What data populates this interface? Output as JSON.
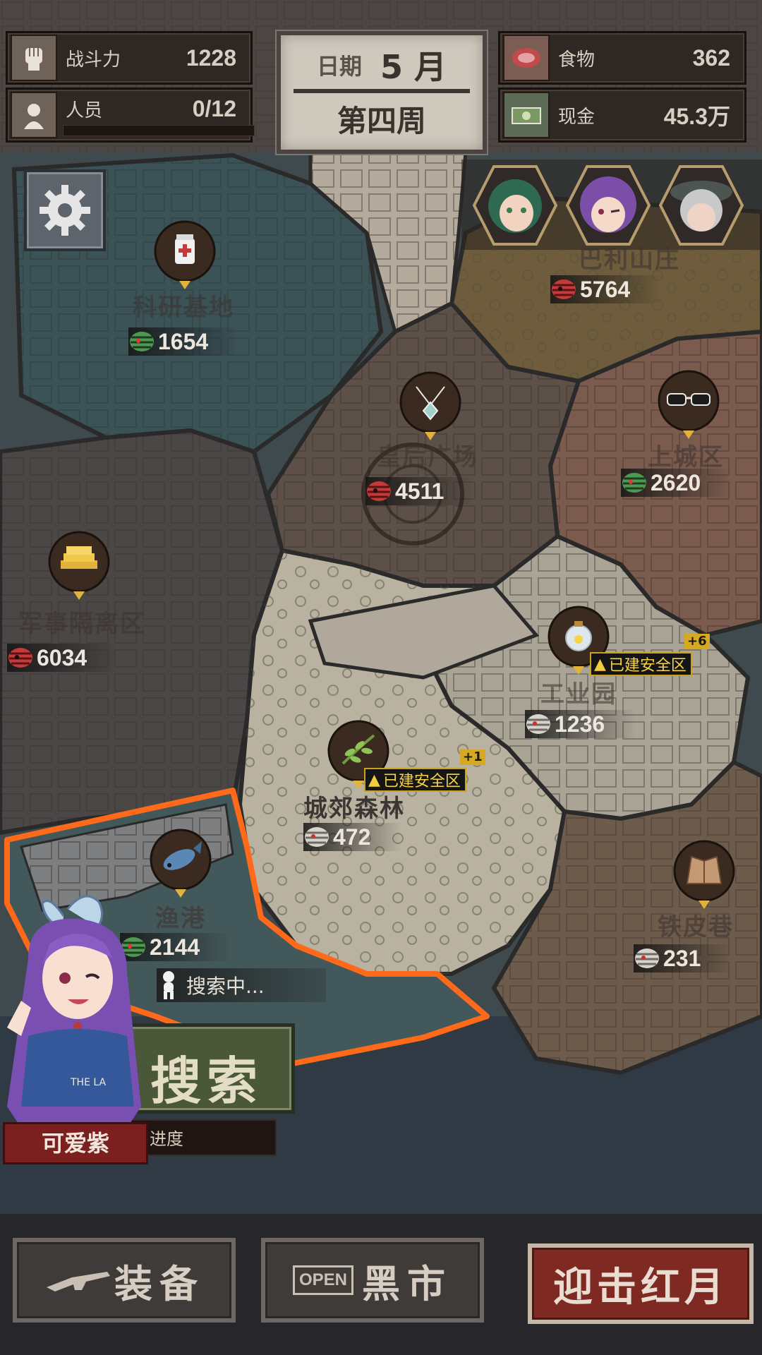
{
  "hud": {
    "combat_label": "战斗力",
    "combat_value": "1228",
    "people_label": "人员",
    "people_value": "0/12",
    "food_label": "食物",
    "food_value": "362",
    "cash_label": "现金",
    "cash_value": "45.3万",
    "date_label": "日期",
    "month": "5 月",
    "week": "第四周"
  },
  "zones": [
    {
      "name": "科研基地",
      "power": "1654",
      "icon": "medicine-bottle-icon",
      "threat": "green"
    },
    {
      "name": "巴利山庄",
      "power": "5764",
      "icon": "",
      "threat": "red"
    },
    {
      "name": "皇后广场",
      "power": "4511",
      "icon": "necklace-icon",
      "threat": "red"
    },
    {
      "name": "上城区",
      "power": "2620",
      "icon": "sunglasses-icon",
      "threat": "green"
    },
    {
      "name": "军事隔离区",
      "power": "6034",
      "icon": "gold-bars-icon",
      "threat": "red"
    },
    {
      "name": "工业园",
      "power": "1236",
      "icon": "lightbulb-icon",
      "threat": "grey"
    },
    {
      "name": "城郊森林",
      "power": "472",
      "icon": "plant-icon",
      "threat": "grey"
    },
    {
      "name": "渔港",
      "power": "2144",
      "icon": "fish-icon",
      "threat": "green"
    },
    {
      "name": "铁皮巷",
      "power": "231",
      "icon": "jacket-icon",
      "threat": "grey"
    }
  ],
  "safe_zone_label": "已建安全区",
  "bonus_industrial": "+6",
  "bonus_forest": "+1",
  "searching_text": "搜索中...",
  "search_button": "搜索",
  "progress_label": "进度",
  "character_name": "可爱紫",
  "bottom": {
    "equipment": "装备",
    "black_market": "黑市",
    "open_sign": "OPEN",
    "red_moon": "迎击红月"
  },
  "colors": {
    "selection": "#ff6a1a",
    "safe_zone_text": "#f4d24a",
    "red_button": "#7e2a22"
  }
}
